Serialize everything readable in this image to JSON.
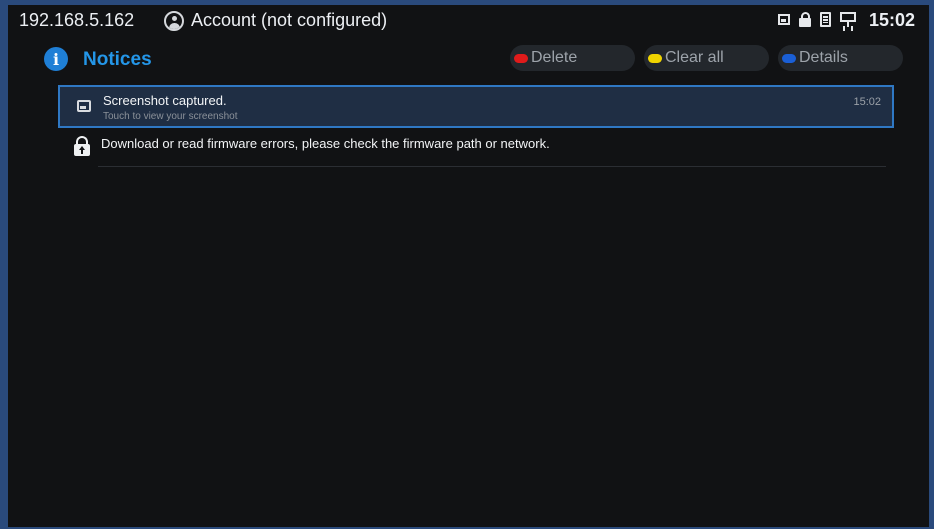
{
  "status_bar": {
    "ip": "192.168.5.162",
    "account": "Account (not configured)",
    "time": "15:02",
    "icons": [
      "screenshot-icon",
      "lock-icon",
      "sd-card-icon",
      "network-icon"
    ]
  },
  "header": {
    "title": "Notices",
    "softkeys": [
      {
        "label": "Delete",
        "color": "#e01b1b"
      },
      {
        "label": "Clear all",
        "color": "#f0d400"
      },
      {
        "label": "Details",
        "color": "#1a5fd6"
      }
    ]
  },
  "notices": [
    {
      "title": "Screenshot captured.",
      "subtitle": "Touch to view your screenshot",
      "time": "15:02",
      "icon": "image-icon",
      "selected": true
    },
    {
      "title": "Download or read firmware errors, please check the firmware path or network.",
      "icon": "firmware-lock-icon",
      "selected": false
    }
  ]
}
